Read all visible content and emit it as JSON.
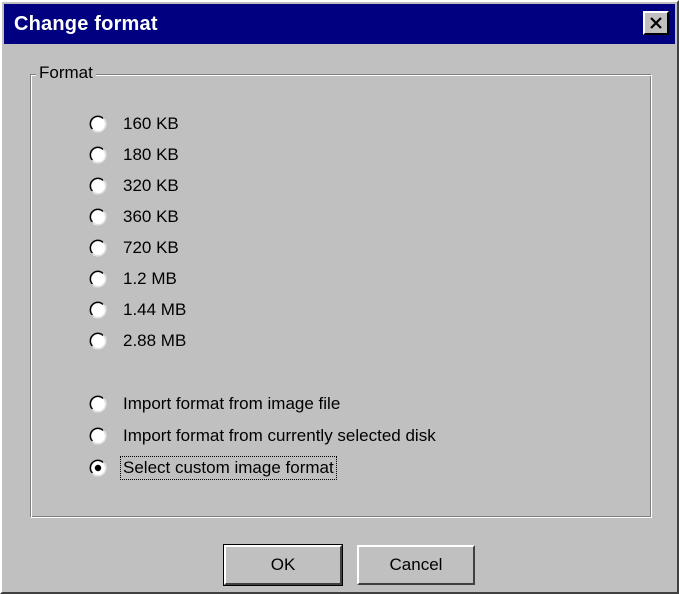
{
  "window": {
    "title": "Change format",
    "close_icon": "close-icon"
  },
  "format_group": {
    "label": "Format",
    "options": [
      {
        "label": "160 KB",
        "checked": false
      },
      {
        "label": "180 KB",
        "checked": false
      },
      {
        "label": "320 KB",
        "checked": false
      },
      {
        "label": "360 KB",
        "checked": false
      },
      {
        "label": "720 KB",
        "checked": false
      },
      {
        "label": "1.2 MB",
        "checked": false
      },
      {
        "label": "1.44 MB",
        "checked": false
      },
      {
        "label": "2.88 MB",
        "checked": false
      }
    ],
    "special_options": [
      {
        "label": "Import format from image file",
        "checked": false
      },
      {
        "label": "Import format from currently selected disk",
        "checked": false
      },
      {
        "label": "Select custom image format",
        "checked": true
      }
    ]
  },
  "buttons": {
    "ok_label": "OK",
    "cancel_label": "Cancel"
  },
  "colors": {
    "titlebar": "#000080",
    "face": "#c0c0c0"
  }
}
